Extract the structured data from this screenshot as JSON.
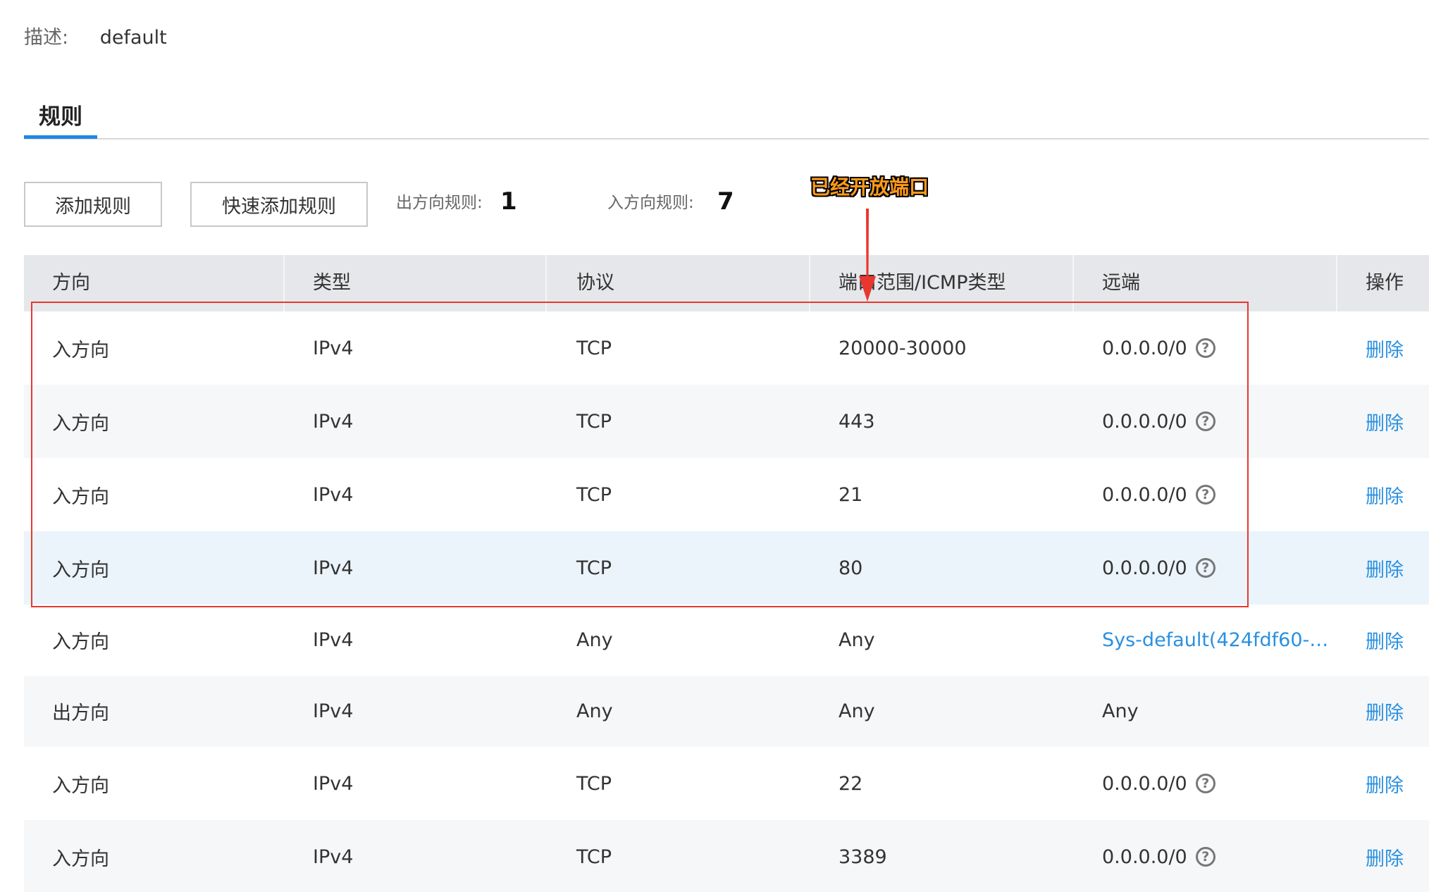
{
  "description": {
    "label": "描述:",
    "value": "default"
  },
  "tabs": {
    "rules_label": "规则"
  },
  "toolbar": {
    "add_rule_label": "添加规则",
    "quick_add_rule_label": "快速添加规则",
    "outbound_label": "出方向规则:",
    "outbound_count": "1",
    "inbound_label": "入方向规则:",
    "inbound_count": "7"
  },
  "annotation": {
    "text": "已经开放端口",
    "color": "#e8372f"
  },
  "table": {
    "columns": [
      "方向",
      "类型",
      "协议",
      "端口范围/ICMP类型",
      "远端",
      "操作"
    ],
    "rows": [
      {
        "direction": "入方向",
        "type": "IPv4",
        "protocol": "TCP",
        "ports": "20000-30000",
        "remote": "0.0.0.0/0",
        "help": "?",
        "action": "删除"
      },
      {
        "direction": "入方向",
        "type": "IPv4",
        "protocol": "TCP",
        "ports": "443",
        "remote": "0.0.0.0/0",
        "help": "?",
        "action": "删除"
      },
      {
        "direction": "入方向",
        "type": "IPv4",
        "protocol": "TCP",
        "ports": "21",
        "remote": "0.0.0.0/0",
        "help": "?",
        "action": "删除"
      },
      {
        "direction": "入方向",
        "type": "IPv4",
        "protocol": "TCP",
        "ports": "80",
        "remote": "0.0.0.0/0",
        "help": "?",
        "action": "删除"
      },
      {
        "direction": "入方向",
        "type": "IPv4",
        "protocol": "Any",
        "ports": "Any",
        "remote": "Sys-default(424fdf60-…",
        "action": "删除"
      },
      {
        "direction": "出方向",
        "type": "IPv4",
        "protocol": "Any",
        "ports": "Any",
        "remote": "Any",
        "action": "删除"
      },
      {
        "direction": "入方向",
        "type": "IPv4",
        "protocol": "TCP",
        "ports": "22",
        "remote": "0.0.0.0/0",
        "help": "?",
        "action": "删除"
      },
      {
        "direction": "入方向",
        "type": "IPv4",
        "protocol": "TCP",
        "ports": "3389",
        "remote": "0.0.0.0/0",
        "help": "?",
        "action": "删除"
      }
    ]
  },
  "colors": {
    "accent": "#1e88e5",
    "link": "#2a90e0",
    "header_bg": "#e6e7ea",
    "row_alt_bg": "#f5f7f8",
    "row_hover_bg": "#eaf4fa",
    "annotation_text": "#ff9a1a"
  }
}
